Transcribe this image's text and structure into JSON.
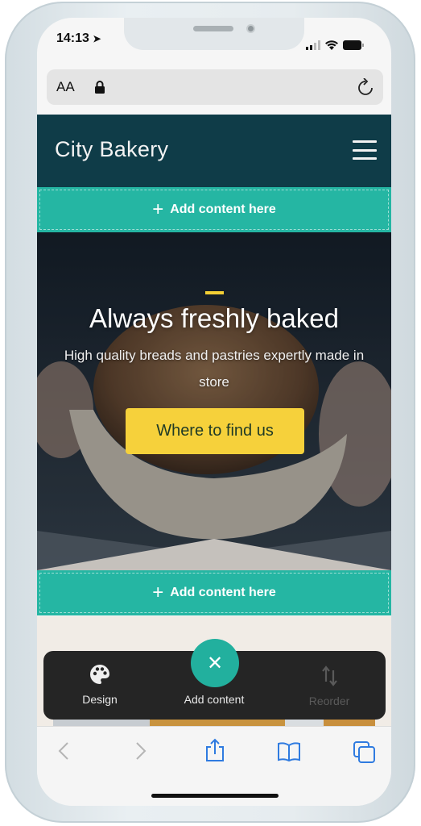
{
  "status_bar": {
    "time": "14:13"
  },
  "browser": {
    "text_size_label": "AA"
  },
  "site": {
    "brand": "City Bakery",
    "add_content_label": "Add content here",
    "hero": {
      "title": "Always freshly baked",
      "subtitle": "High quality breads and pastries expertly made in store",
      "cta": "Where to find us"
    }
  },
  "editor_toolbar": {
    "design": "Design",
    "add_content": "Add content",
    "reorder": "Reorder"
  },
  "colors": {
    "header": "#0f3c48",
    "accent": "#25b6a3",
    "cta": "#f6d13b",
    "toolbar": "#252525",
    "ios_blue": "#2f7be0"
  }
}
